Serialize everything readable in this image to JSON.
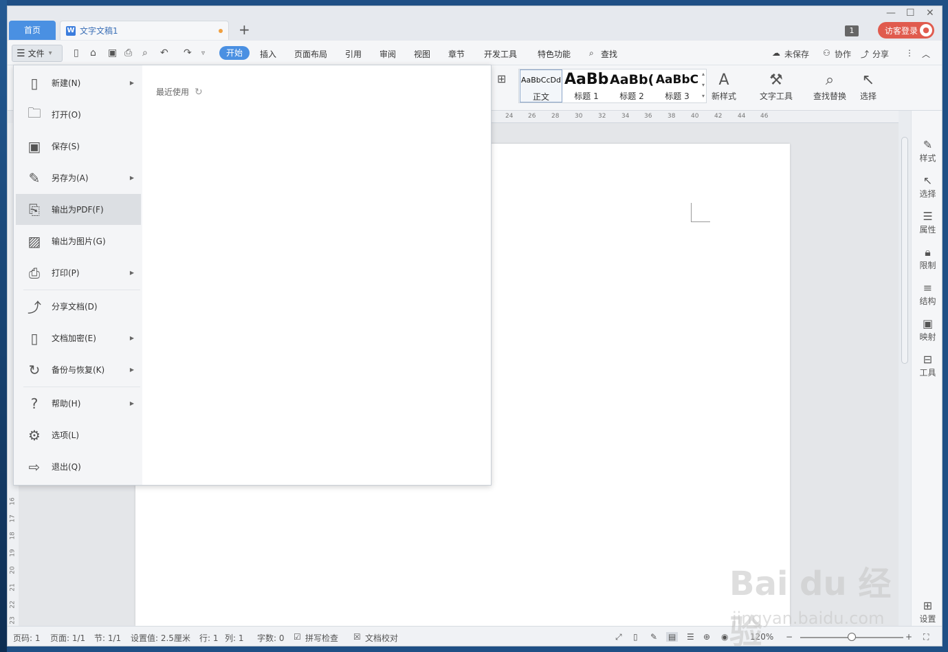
{
  "tabs": {
    "home": "首页",
    "document": "文字文稿1",
    "new_tab": "+"
  },
  "window": {
    "badge": "1",
    "guest_login": "访客登录",
    "minimize": "—",
    "maximize": "☐",
    "close": "✕"
  },
  "menubar": {
    "file": "文件",
    "items": [
      "开始",
      "插入",
      "页面布局",
      "引用",
      "审阅",
      "视图",
      "章节",
      "开发工具",
      "特色功能",
      "查找"
    ],
    "right": [
      "未保存",
      "协作",
      "分享"
    ]
  },
  "ribbon": {
    "styles": [
      {
        "preview": "AaBbCcDd",
        "label": "正文"
      },
      {
        "preview": "AaBb",
        "label": "标题 1"
      },
      {
        "preview": "AaBb(",
        "label": "标题 2"
      },
      {
        "preview": "AaBbC",
        "label": "标题 3"
      }
    ],
    "tools": [
      "新样式",
      "文字工具",
      "查找替换",
      "选择"
    ]
  },
  "ruler": {
    "top_ticks": [
      "24",
      "26",
      "28",
      "30",
      "32",
      "34",
      "36",
      "38",
      "40",
      "42",
      "44",
      "46"
    ],
    "left_ticks": [
      "16",
      "17",
      "18",
      "19",
      "20",
      "21",
      "22",
      "23"
    ]
  },
  "sidebar": {
    "items": [
      "样式",
      "选择",
      "属性",
      "限制",
      "结构",
      "映射",
      "工具"
    ],
    "settings": "设置"
  },
  "file_menu": {
    "items": [
      {
        "label": "新建(N)",
        "icon": "new-doc-icon",
        "submenu": true
      },
      {
        "label": "打开(O)",
        "icon": "folder-icon",
        "submenu": false
      },
      {
        "label": "保存(S)",
        "icon": "save-icon",
        "submenu": false
      },
      {
        "label": "另存为(A)",
        "icon": "save-as-icon",
        "submenu": true
      },
      {
        "label": "输出为PDF(F)",
        "icon": "pdf-icon",
        "submenu": false
      },
      {
        "label": "输出为图片(G)",
        "icon": "image-icon",
        "submenu": false
      },
      {
        "label": "打印(P)",
        "icon": "printer-icon",
        "submenu": true
      },
      {
        "label": "分享文档(D)",
        "icon": "share-icon",
        "submenu": false
      },
      {
        "label": "文档加密(E)",
        "icon": "lock-doc-icon",
        "submenu": true
      },
      {
        "label": "备份与恢复(K)",
        "icon": "backup-icon",
        "submenu": true
      },
      {
        "label": "帮助(H)",
        "icon": "help-icon",
        "submenu": true
      },
      {
        "label": "选项(L)",
        "icon": "gear-icon",
        "submenu": false
      },
      {
        "label": "退出(Q)",
        "icon": "exit-icon",
        "submenu": false
      }
    ],
    "recent": "最近使用"
  },
  "statusbar": {
    "page_code": "页码: 1",
    "pages": "页面: 1/1",
    "section": "节: 1/1",
    "setting": "设置值: 2.5厘米",
    "row": "行: 1",
    "col": "列: 1",
    "words": "字数: 0",
    "spell": "拼写检查",
    "proof": "文档校对",
    "zoom": "120%"
  },
  "watermark": {
    "brand": "Bai du 经验",
    "url": "jingyan.baidu.com"
  }
}
